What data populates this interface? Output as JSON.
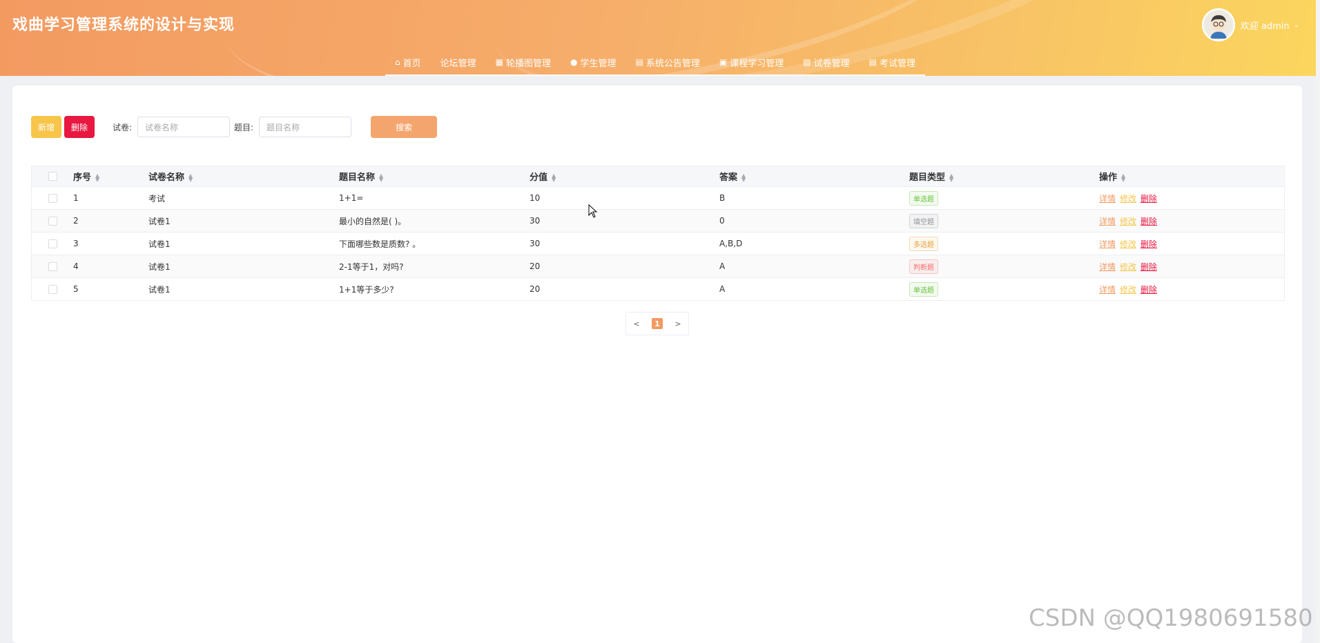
{
  "header": {
    "title": "戏曲学习管理系统的设计与实现",
    "welcome": "欢迎 admin",
    "nav": [
      {
        "label": "首页",
        "icon": "home-icon"
      },
      {
        "label": "论坛管理",
        "icon": ""
      },
      {
        "label": "轮播图管理",
        "icon": "grid-icon"
      },
      {
        "label": "学生管理",
        "icon": "user-icon"
      },
      {
        "label": "系统公告管理",
        "icon": "doc-icon"
      },
      {
        "label": "课程学习管理",
        "icon": "bag-icon"
      },
      {
        "label": "试卷管理",
        "icon": "book-icon"
      },
      {
        "label": "考试管理",
        "icon": "doc-icon"
      }
    ]
  },
  "toolbar": {
    "add_label": "新增",
    "delete_label": "删除",
    "paper_label": "试卷:",
    "paper_placeholder": "试卷名称",
    "question_label": "题目:",
    "question_placeholder": "题目名称",
    "search_label": "搜索"
  },
  "table": {
    "headers": [
      "序号",
      "试卷名称",
      "题目名称",
      "分值",
      "答案",
      "题目类型",
      "操作"
    ],
    "rows": [
      {
        "idx": "1",
        "paper": "考试",
        "question": "1+1=",
        "score": "10",
        "answer": "B",
        "type": "单选题"
      },
      {
        "idx": "2",
        "paper": "试卷1",
        "question": "最小的自然是( )。",
        "score": "30",
        "answer": "0",
        "type": "填空题"
      },
      {
        "idx": "3",
        "paper": "试卷1",
        "question": "下面哪些数是质数? 。",
        "score": "30",
        "answer": "A,B,D",
        "type": "多选题"
      },
      {
        "idx": "4",
        "paper": "试卷1",
        "question": "2-1等于1，对吗?",
        "score": "20",
        "answer": "A",
        "type": "判断题"
      },
      {
        "idx": "5",
        "paper": "试卷1",
        "question": "1+1等于多少?",
        "score": "20",
        "answer": "A",
        "type": "单选题"
      }
    ],
    "ops": {
      "detail": "详情",
      "edit": "修改",
      "delete": "删除"
    }
  },
  "pagination": {
    "prev": "<",
    "current": "1",
    "next": ">"
  },
  "tag_colors": {
    "单选题": "#67c23a",
    "填空题": "#909399",
    "多选题": "#e6a23c",
    "判断题": "#f56c6c"
  },
  "watermark": "CSDN @QQ1980691580"
}
